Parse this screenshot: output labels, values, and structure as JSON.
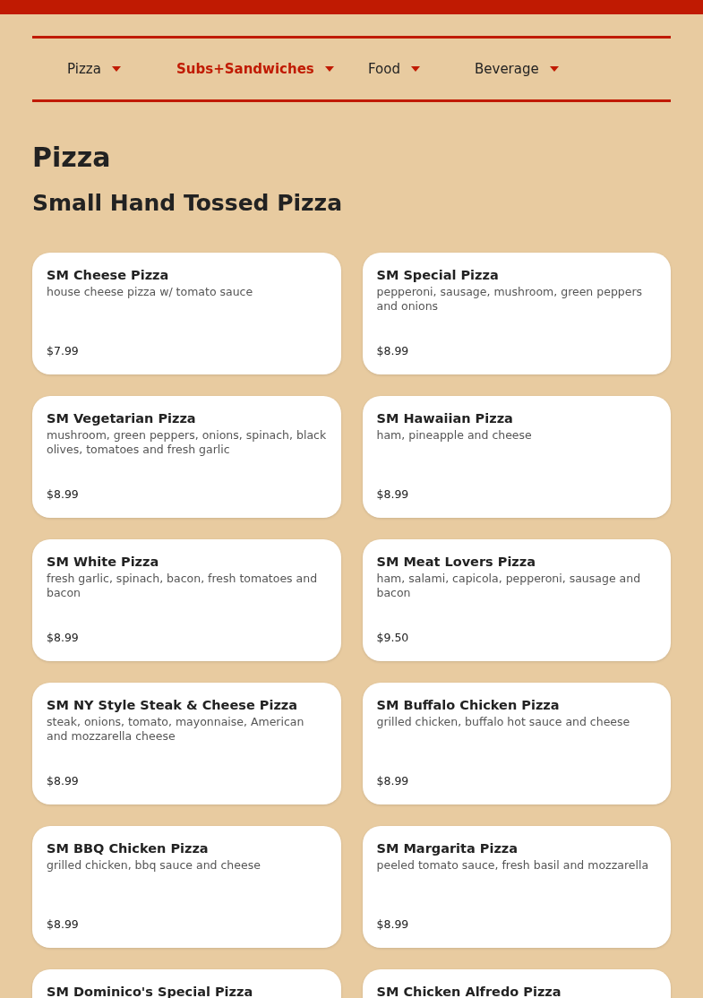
{
  "nav": [
    {
      "label": "Pizza",
      "selected": false
    },
    {
      "label": "Subs+Sandwiches",
      "selected": true
    },
    {
      "label": "Food",
      "selected": false
    },
    {
      "label": "Beverage",
      "selected": false
    }
  ],
  "section_title": "Pizza",
  "subsection_title": "Small Hand Tossed Pizza",
  "items": [
    {
      "name": "SM Cheese Pizza",
      "description": "house cheese pizza w/ tomato sauce",
      "price": "$7.99"
    },
    {
      "name": "SM Special Pizza",
      "description": "pepperoni, sausage, mushroom, green peppers and onions",
      "price": "$8.99"
    },
    {
      "name": "SM Vegetarian Pizza",
      "description": "mushroom, green peppers, onions, spinach, black olives, tomatoes and fresh garlic",
      "price": "$8.99"
    },
    {
      "name": "SM Hawaiian Pizza",
      "description": "ham, pineapple and cheese",
      "price": "$8.99"
    },
    {
      "name": "SM White Pizza",
      "description": "fresh garlic, spinach, bacon, fresh tomatoes and bacon",
      "price": "$8.99"
    },
    {
      "name": "SM Meat Lovers Pizza",
      "description": "ham, salami, capicola, pepperoni, sausage and bacon",
      "price": "$9.50"
    },
    {
      "name": "SM NY Style Steak & Cheese Pizza",
      "description": "steak, onions, tomato, mayonnaise, American and mozzarella cheese",
      "price": "$8.99"
    },
    {
      "name": "SM Buffalo Chicken Pizza",
      "description": "grilled chicken, buffalo hot sauce and cheese",
      "price": "$8.99"
    },
    {
      "name": "SM BBQ Chicken Pizza",
      "description": "grilled chicken, bbq sauce and cheese",
      "price": "$8.99"
    },
    {
      "name": "SM Margarita Pizza",
      "description": "peeled tomato sauce, fresh basil and mozzarella",
      "price": "$8.99"
    },
    {
      "name": "SM Dominico's Special Pizza"
    },
    {
      "name": "SM Chicken Alfredo Pizza"
    }
  ]
}
